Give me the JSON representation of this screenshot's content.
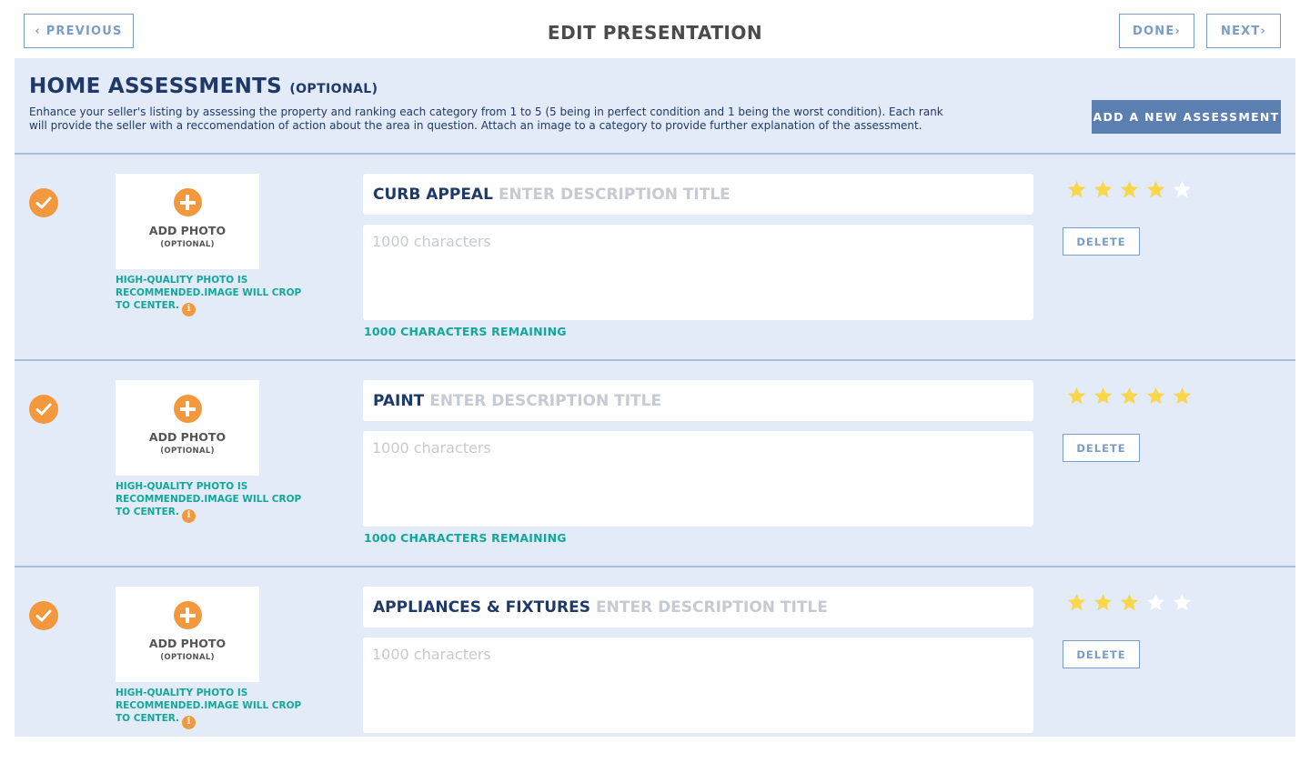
{
  "header": {
    "title": "EDIT PRESENTATION",
    "previous_label": "‹ PREVIOUS",
    "done_label": "DONE›",
    "next_label": "NEXT›"
  },
  "section": {
    "title": "HOME ASSESSMENTS",
    "title_suffix": "(OPTIONAL)",
    "description": "Enhance your seller's listing by assessing the property and ranking each category from 1 to 5 (5 being in perfect condition and 1 being the worst condition). Each rank will provide the seller with a reccomendation of action about the area in question. Attach an image to a category to provide further explanation of the assessment.",
    "add_button_label": "ADD A NEW ASSESSMENT"
  },
  "photo": {
    "add_label": "ADD PHOTO",
    "optional_label": "(OPTIONAL)",
    "hint": "HIGH-QUALITY PHOTO IS RECOMMENDED.IMAGE WILL CROP TO CENTER.",
    "info_glyph": "i"
  },
  "colors": {
    "accent_orange": "#f4983e",
    "teal_text": "#11a89a",
    "star_on": "#f9d64a",
    "star_off": "#ffffff",
    "navy": "#1f3a68"
  },
  "assessments": [
    {
      "category": "CURB APPEAL",
      "title_placeholder": "ENTER DESCRIPTION TITLE",
      "desc_placeholder": "1000 characters",
      "remaining": "1000 CHARACTERS REMAINING",
      "rating": 4,
      "max_rating": 5,
      "delete_label": "DELETE"
    },
    {
      "category": "PAINT",
      "title_placeholder": "ENTER DESCRIPTION TITLE",
      "desc_placeholder": "1000 characters",
      "remaining": "1000 CHARACTERS REMAINING",
      "rating": 5,
      "max_rating": 5,
      "delete_label": "DELETE"
    },
    {
      "category": "APPLIANCES & FIXTURES",
      "title_placeholder": "ENTER DESCRIPTION TITLE",
      "desc_placeholder": "1000 characters",
      "remaining": "",
      "rating": 3,
      "max_rating": 5,
      "delete_label": "DELETE"
    }
  ]
}
